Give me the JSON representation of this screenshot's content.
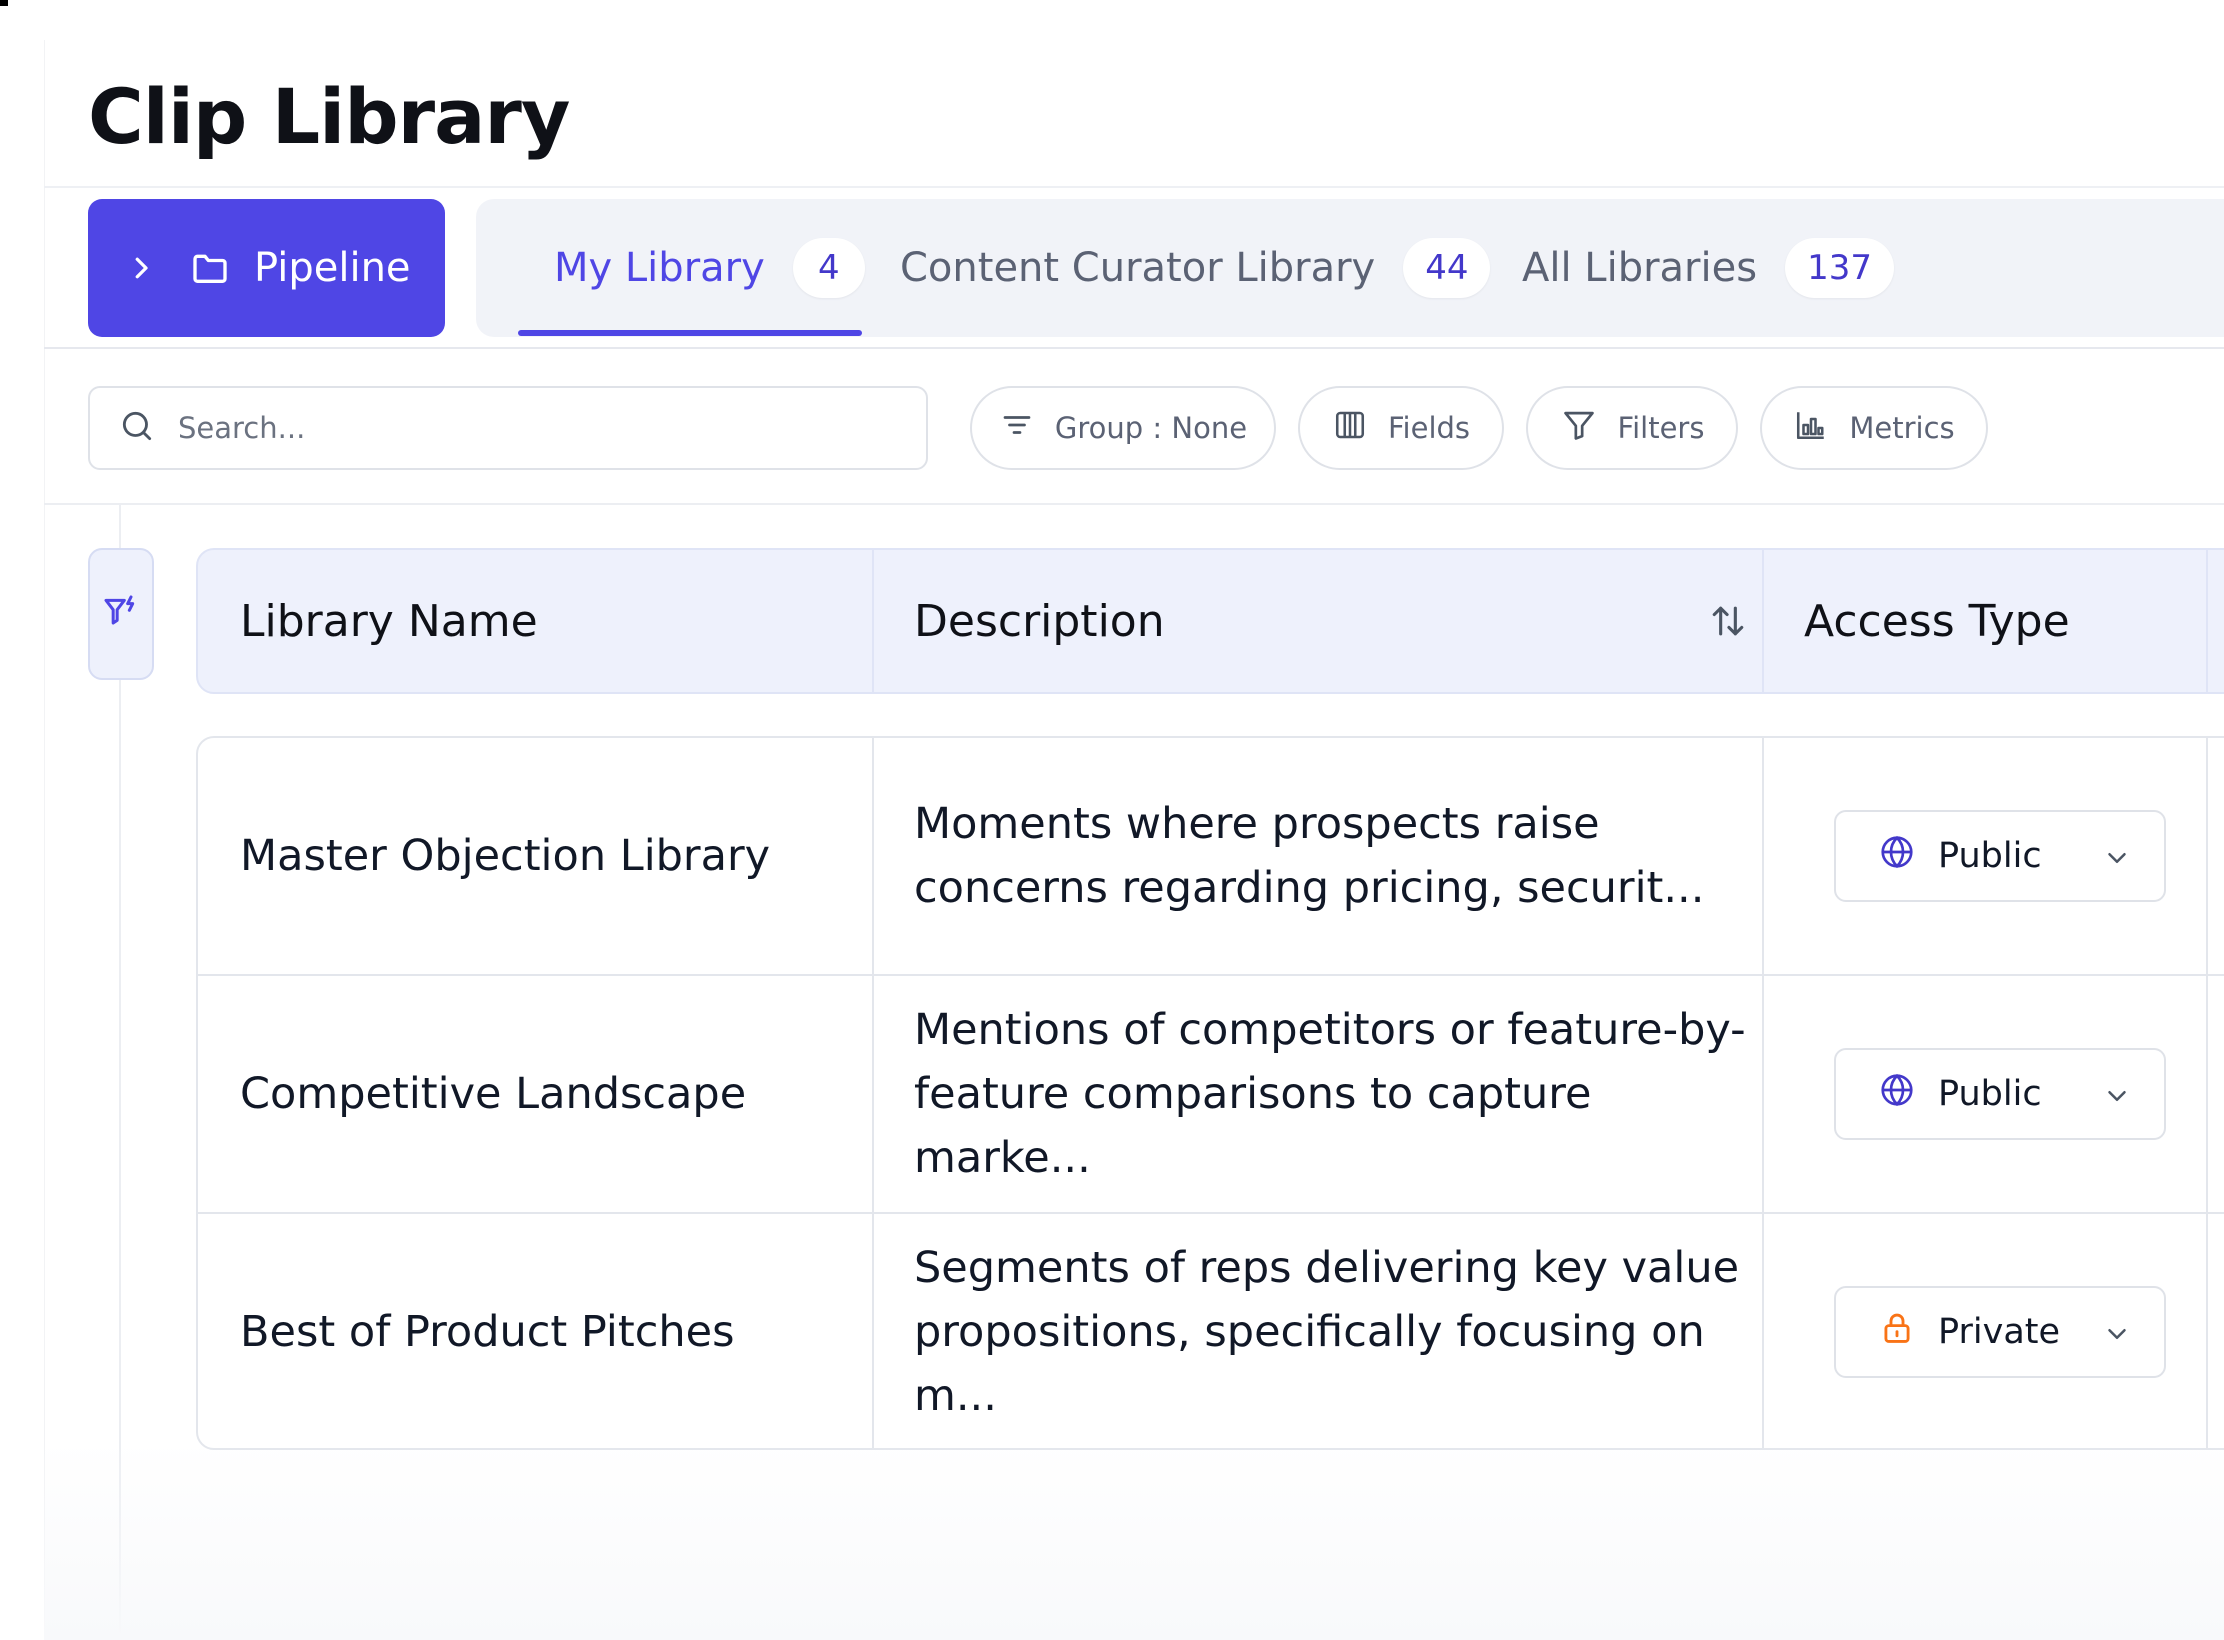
{
  "page": {
    "title": "Clip Library"
  },
  "tabs": {
    "pipeline": {
      "label": "Pipeline",
      "icons": [
        "chevron-right-icon",
        "folder-icon"
      ]
    },
    "items": [
      {
        "label": "My Library",
        "count": "4",
        "active": true
      },
      {
        "label": "Content Curator Library",
        "count": "44",
        "active": false
      },
      {
        "label": "All Libraries",
        "count": "137",
        "active": false
      }
    ]
  },
  "toolbar": {
    "search": {
      "placeholder": "Search...",
      "value": "",
      "icon": "search-icon"
    },
    "group_label": "Group : None",
    "fields_label": "Fields",
    "filters_label": "Filters",
    "metrics_label": "Metrics",
    "icons": [
      "sort-lines-icon",
      "columns-icon",
      "funnel-icon",
      "bar-chart-icon"
    ]
  },
  "table": {
    "columns": [
      {
        "label": "Library Name"
      },
      {
        "label": "Description",
        "sort_icon": "sort-arrows-icon"
      },
      {
        "label": "Access Type"
      }
    ],
    "rows": [
      {
        "name": "Master Objection Library",
        "description_line1": "Moments where prospects raise",
        "description_line2": "concerns regarding pricing, securit...",
        "access": "Public",
        "access_icon": "globe-icon"
      },
      {
        "name": "Competitive Landscape",
        "description_line1": "Mentions of competitors or feature-by-",
        "description_line2": "feature comparisons to capture marke...",
        "access": "Public",
        "access_icon": "globe-icon"
      },
      {
        "name": "Best of Product Pitches",
        "description_line1": "Segments of reps delivering key value",
        "description_line2": "propositions, specifically focusing on m...",
        "access": "Private",
        "access_icon": "lock-icon"
      }
    ]
  },
  "colors": {
    "accent": "#4f46e5",
    "tab_bg": "#f1f3f8",
    "header_bg": "#eef1fc",
    "globe": "#4338ca",
    "lock": "#f97316"
  }
}
